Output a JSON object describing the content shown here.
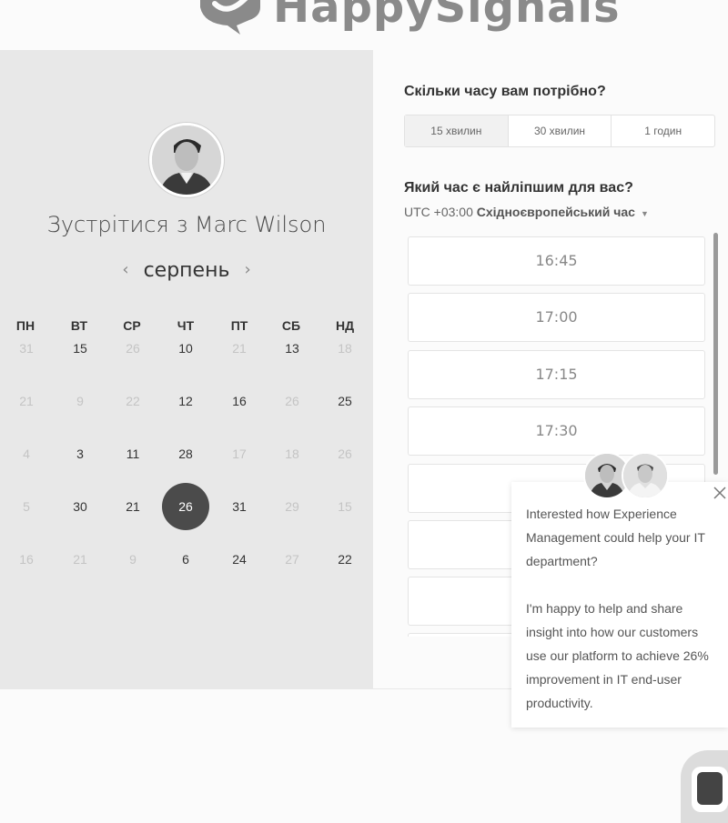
{
  "brand": {
    "name": "HappySignals"
  },
  "calendar": {
    "title": "Зустрітися з Marc Wilson",
    "month": "серпень",
    "prev_arrow": "‹",
    "next_arrow": "›",
    "weekdays": [
      "ПН",
      "ВТ",
      "СР",
      "ЧТ",
      "ПТ",
      "СБ",
      "НД"
    ],
    "weeks": [
      [
        {
          "d": "31",
          "s": "dim"
        },
        {
          "d": "15",
          "s": "avail"
        },
        {
          "d": "26",
          "s": "dim"
        },
        {
          "d": "10",
          "s": "avail"
        },
        {
          "d": "21",
          "s": "dim"
        },
        {
          "d": "13",
          "s": "avail"
        },
        {
          "d": "18",
          "s": "dim"
        }
      ],
      [
        {
          "d": "21",
          "s": "dim"
        },
        {
          "d": "9",
          "s": "dim"
        },
        {
          "d": "22",
          "s": "dim"
        },
        {
          "d": "12",
          "s": "avail"
        },
        {
          "d": "16",
          "s": "avail"
        },
        {
          "d": "26",
          "s": "dim"
        },
        {
          "d": "25",
          "s": "avail"
        }
      ],
      [
        {
          "d": "4",
          "s": "dim"
        },
        {
          "d": "3",
          "s": "avail"
        },
        {
          "d": "11",
          "s": "avail"
        },
        {
          "d": "28",
          "s": "avail"
        },
        {
          "d": "17",
          "s": "dim"
        },
        {
          "d": "18",
          "s": "dim"
        },
        {
          "d": "26",
          "s": "dim"
        }
      ],
      [
        {
          "d": "5",
          "s": "dim"
        },
        {
          "d": "30",
          "s": "avail"
        },
        {
          "d": "21",
          "s": "avail"
        },
        {
          "d": "26",
          "s": "selected"
        },
        {
          "d": "31",
          "s": "avail"
        },
        {
          "d": "29",
          "s": "dim"
        },
        {
          "d": "15",
          "s": "dim"
        }
      ],
      [
        {
          "d": "16",
          "s": "dim"
        },
        {
          "d": "21",
          "s": "dim"
        },
        {
          "d": "9",
          "s": "dim"
        },
        {
          "d": "6",
          "s": "avail"
        },
        {
          "d": "24",
          "s": "avail"
        },
        {
          "d": "27",
          "s": "dim"
        },
        {
          "d": "22",
          "s": "avail"
        }
      ]
    ]
  },
  "duration": {
    "label": "Скільки часу вам потрібно?",
    "options": [
      "15 хвилин",
      "30 хвилин",
      "1 годин"
    ],
    "selected_index": 0
  },
  "time": {
    "label": "Який час є найліпшим для вас?",
    "timezone_prefix": "UTC +03:00",
    "timezone_name": "Східноєвропейський час",
    "slots": [
      "16:45",
      "17:00",
      "17:15",
      "17:30",
      "",
      "",
      "",
      ""
    ]
  },
  "popup": {
    "paragraph1": "Interested how Experience Management could help your IT department?",
    "paragraph2": "I'm happy to help and share insight into how our customers use our platform to achieve 26% improvement in IT end-user productivity."
  }
}
